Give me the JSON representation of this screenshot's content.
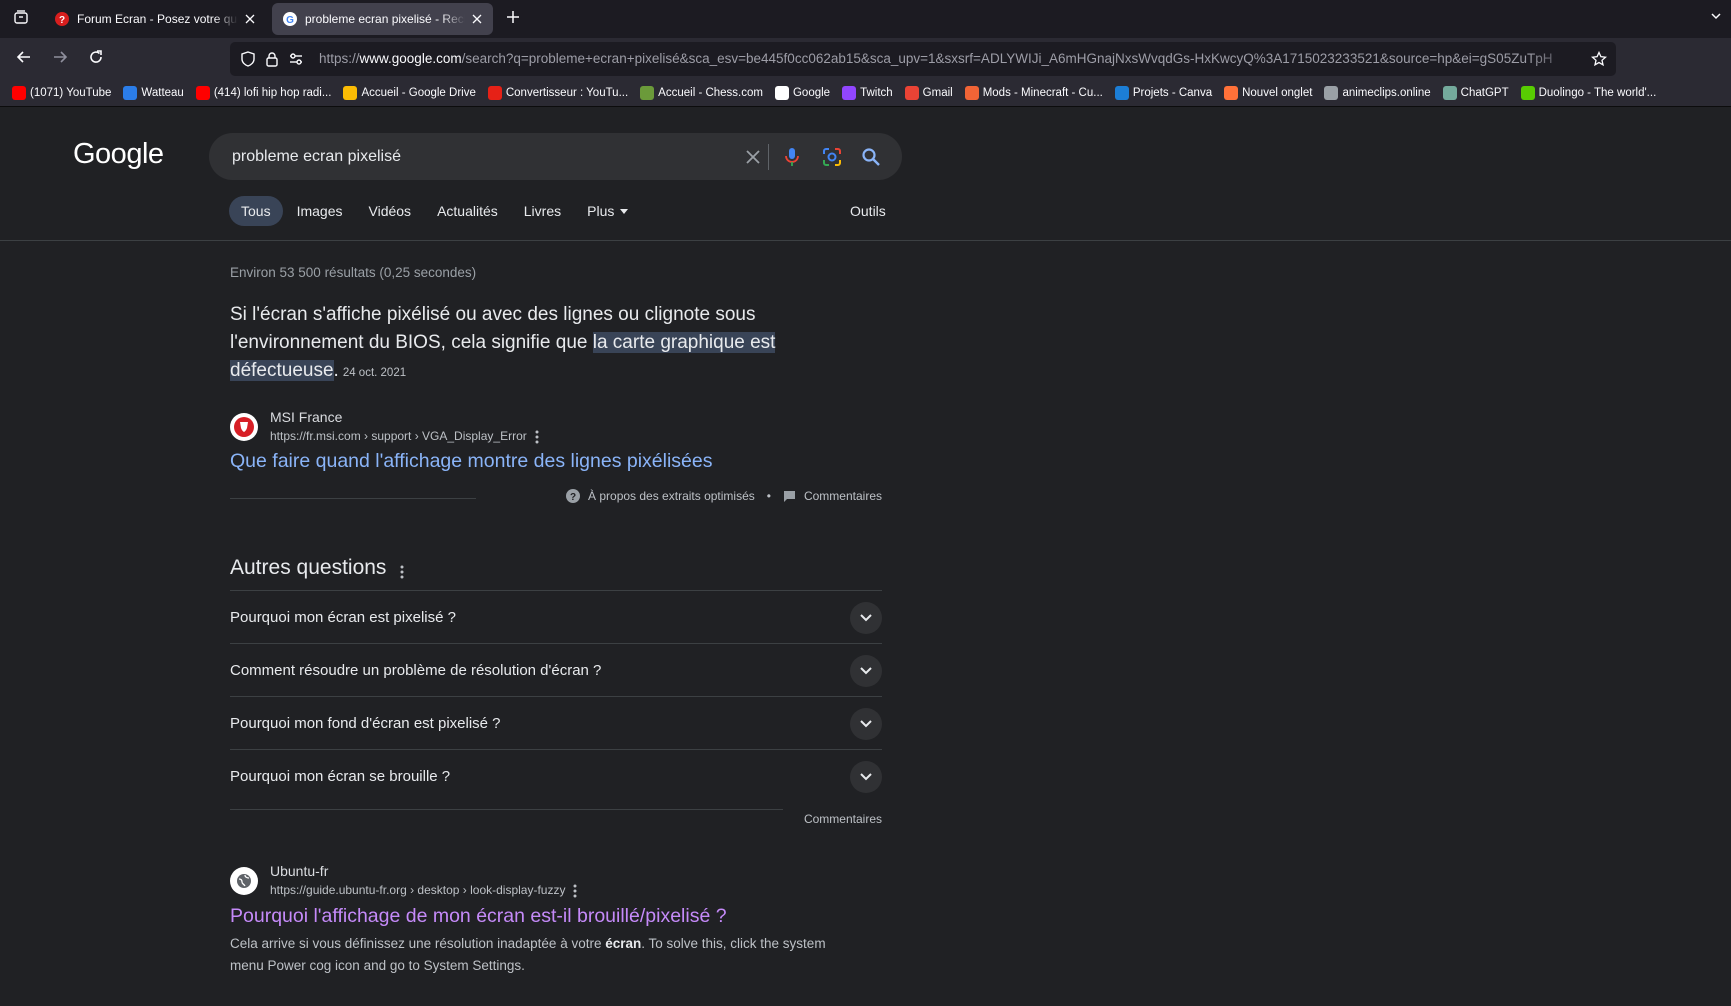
{
  "browser": {
    "tabs": [
      {
        "title": "Forum Ecran - Posez votre question",
        "active": false
      },
      {
        "title": "probleme ecran pixelisé - Recherche Google",
        "active": true
      }
    ],
    "url_domain": "www.google.com",
    "url_prefix": "https://",
    "url_rest": "/search?q=probleme+ecran+pixelisé&sca_esv=be445f0cc062ab15&sca_upv=1&sxsrf=ADLYWIJi_A6mHGnajNxsWvqdGs-HxKwcyQ%3A1715023233521&source=hp&ei=gS05ZuTpH",
    "bookmarks": [
      {
        "label": "(1071) YouTube",
        "color": "#ff0000"
      },
      {
        "label": "Watteau",
        "color": "#2b7de9"
      },
      {
        "label": "(414) lofi hip hop radi...",
        "color": "#ff0000"
      },
      {
        "label": "Accueil - Google Drive",
        "color": "#fbbc04"
      },
      {
        "label": "Convertisseur : YouTu...",
        "color": "#e62117"
      },
      {
        "label": "Accueil - Chess.com",
        "color": "#6b9a3a"
      },
      {
        "label": "Google",
        "color": "#ffffff"
      },
      {
        "label": "Twitch",
        "color": "#9146ff"
      },
      {
        "label": "Gmail",
        "color": "#ea4335"
      },
      {
        "label": "Mods - Minecraft - Cu...",
        "color": "#f16436"
      },
      {
        "label": "Projets - Canva",
        "color": "#1c7ed6"
      },
      {
        "label": "Nouvel onglet",
        "color": "#ff7139"
      },
      {
        "label": "animeclips.online",
        "color": "#9aa0a6"
      },
      {
        "label": "ChatGPT",
        "color": "#74aa9c"
      },
      {
        "label": "Duolingo - The world'...",
        "color": "#58cc02"
      }
    ]
  },
  "google": {
    "logo": "Google",
    "query": "probleme ecran pixelisé",
    "tabs": [
      "Tous",
      "Images",
      "Vidéos",
      "Actualités",
      "Livres",
      "Plus"
    ],
    "tools": "Outils",
    "stats": "Environ 53 500 résultats (0,25 secondes)",
    "featured": {
      "text_before": "Si l'écran s'affiche pixélisé ou avec des lignes ou clignote sous l'environnement du BIOS, cela signifie que ",
      "highlight": "la carte graphique est défectueuse",
      "text_after": ".",
      "date": "24 oct. 2021",
      "source_name": "MSI France",
      "source_url": "https://fr.msi.com › support › VGA_Display_Error",
      "link": "Que faire quand l'affichage montre des lignes pixélisées",
      "about": "À propos des extraits optimisés",
      "feedback": "Commentaires"
    },
    "paa": {
      "title": "Autres questions",
      "questions": [
        "Pourquoi mon écran est pixelisé ?",
        "Comment résoudre un problème de résolution d'écran ?",
        "Pourquoi mon fond d'écran est pixelisé ?",
        "Pourquoi mon écran se brouille ?"
      ],
      "feedback": "Commentaires"
    },
    "result2": {
      "source_name": "Ubuntu-fr",
      "source_url": "https://guide.ubuntu-fr.org › desktop › look-display-fuzzy",
      "link": "Pourquoi l'affichage de mon écran est-il brouillé/pixelisé ?",
      "desc_before": "Cela arrive si vous définissez une résolution inadaptée à votre ",
      "desc_bold": "écran",
      "desc_after": ". To solve this, click the system menu Power cog icon and go to System Settings."
    }
  }
}
